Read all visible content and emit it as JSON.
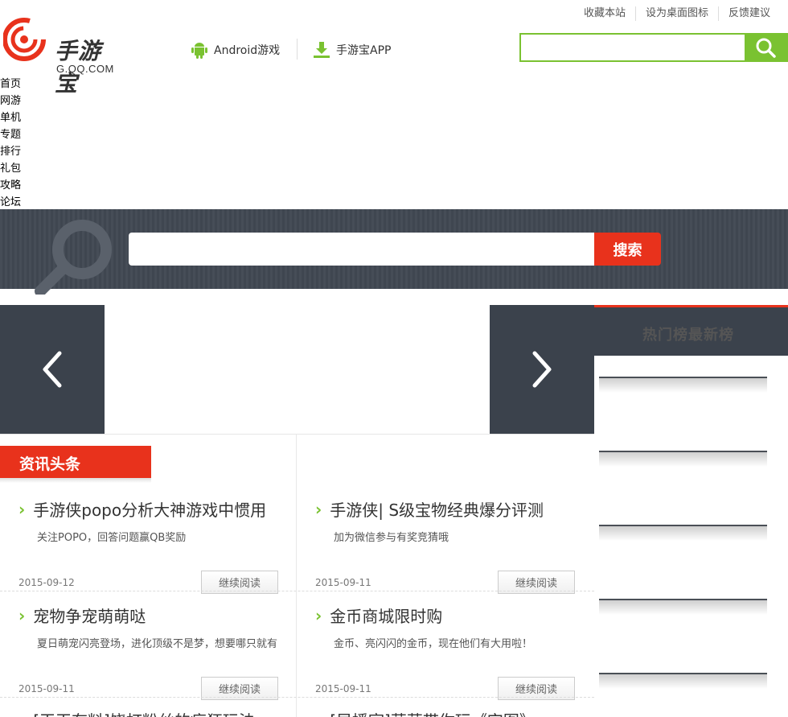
{
  "logo": {
    "text": "手游宝",
    "sub": "G.QQ.COM",
    "color": "#e8321c"
  },
  "nav": {
    "android_label": "Android游戏",
    "app_label": "手游宝APP"
  },
  "top_links": [
    "收藏本站",
    "设为桌面图标",
    "反馈建议"
  ],
  "top_search": {
    "placeholder": ""
  },
  "side_menu": [
    "首页",
    "网游",
    "单机",
    "专题",
    "排行",
    "礼包",
    "攻略",
    "论坛"
  ],
  "band_search": {
    "placeholder": "",
    "button": "搜索"
  },
  "rank": {
    "title": "热门榜最新榜"
  },
  "news": {
    "tag": "资讯头条",
    "items": [
      {
        "title": "手游侠popo分析大神游戏中惯用",
        "desc": "关注POPO，回答问题赢QB奖励",
        "date": "2015-09-12",
        "more": "继续阅读"
      },
      {
        "title": "手游侠| S级宝物经典爆分评测",
        "desc": "加为微信参与有奖竞猜哦",
        "date": "2015-09-11",
        "more": "继续阅读"
      },
      {
        "title": "宠物争宠萌萌哒",
        "desc": "夏日萌宠闪亮登场，进化顶级不是梦，想要哪只就有",
        "date": "2015-09-11",
        "more": "继续阅读"
      },
      {
        "title": "金币商城限时购",
        "desc": "金币、亮闪闪的金币，现在他们有大用啦！",
        "date": "2015-09-11",
        "more": "继续阅读"
      },
      {
        "title": "[干干有料]饶打粉丝的疯狂玩法",
        "desc": "",
        "date": "",
        "more": ""
      },
      {
        "title": "[早播室]草草带你玩《宫图》",
        "desc": "",
        "date": "",
        "more": ""
      }
    ]
  },
  "colors": {
    "accent": "#7ac231",
    "red": "#e8321c",
    "dark": "#3b424c"
  }
}
